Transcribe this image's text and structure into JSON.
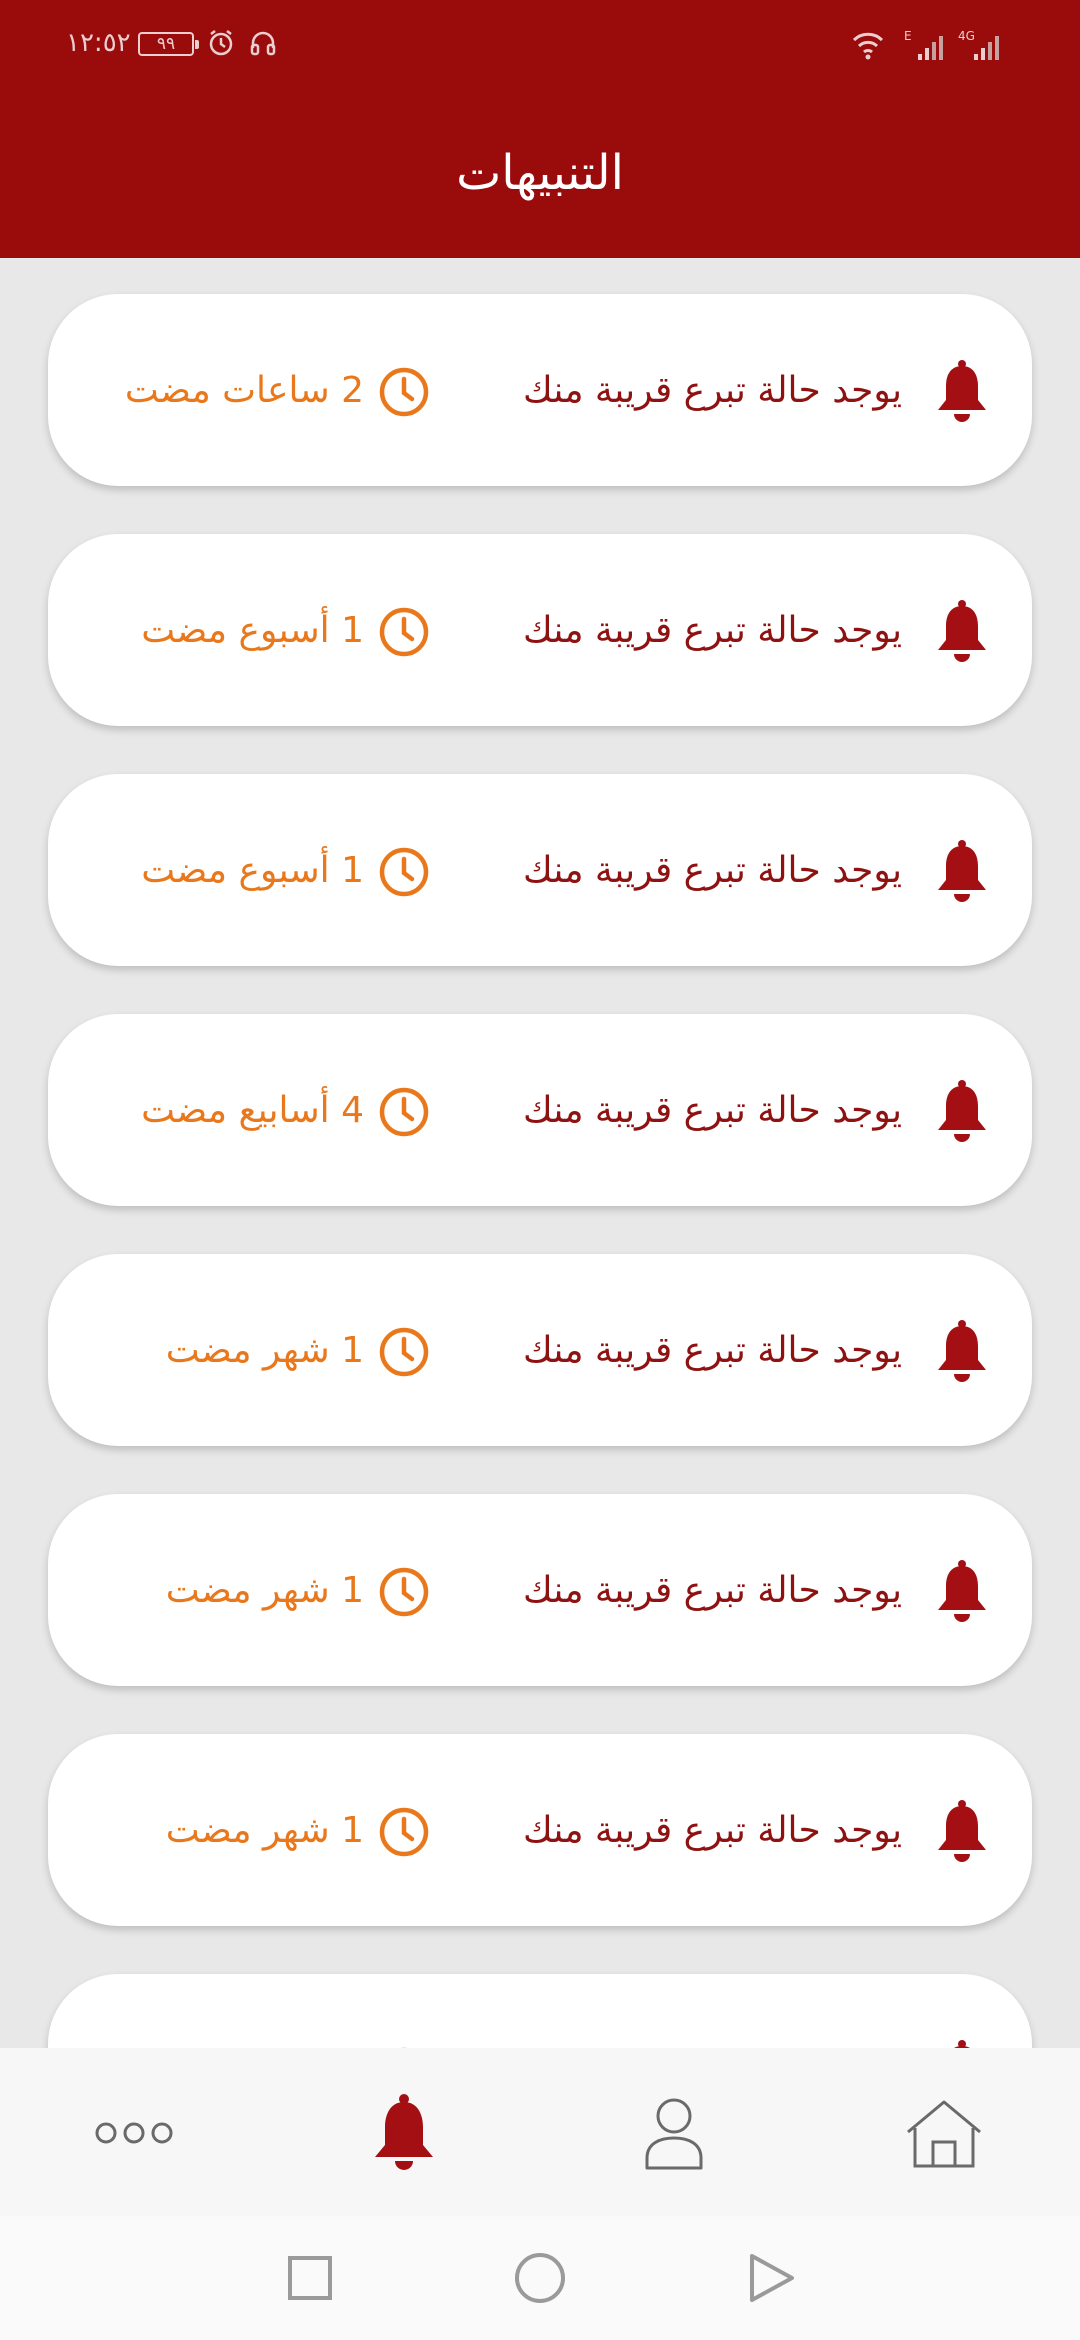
{
  "status_bar": {
    "time": "١٢:٥٢",
    "battery": "٩٩"
  },
  "header": {
    "title": "التنبيهات"
  },
  "notifications": [
    {
      "message": "يوجد حالة تبرع قريبة منك",
      "time_ago": "2 ساعات مضت"
    },
    {
      "message": "يوجد حالة تبرع قريبة منك",
      "time_ago": "1 أسبوع مضت"
    },
    {
      "message": "يوجد حالة تبرع قريبة منك",
      "time_ago": "1 أسبوع مضت"
    },
    {
      "message": "يوجد حالة تبرع قريبة منك",
      "time_ago": "4 أسابيع مضت"
    },
    {
      "message": "يوجد حالة تبرع قريبة منك",
      "time_ago": "1 شهر مضت"
    },
    {
      "message": "يوجد حالة تبرع قريبة منك",
      "time_ago": "1 شهر مضت"
    },
    {
      "message": "يوجد حالة تبرع قريبة منك",
      "time_ago": "1 شهر مضت"
    },
    {
      "message": "",
      "time_ago": ""
    }
  ],
  "bottom_nav": {
    "items": [
      {
        "icon": "more-dots-icon",
        "active": false
      },
      {
        "icon": "bell-icon",
        "active": true
      },
      {
        "icon": "profile-icon",
        "active": false
      },
      {
        "icon": "home-icon",
        "active": false
      }
    ]
  },
  "colors": {
    "header": "#9a0b0c",
    "message_text": "#8f1212",
    "time_text": "#e9781c",
    "background": "#e8e8e8"
  }
}
